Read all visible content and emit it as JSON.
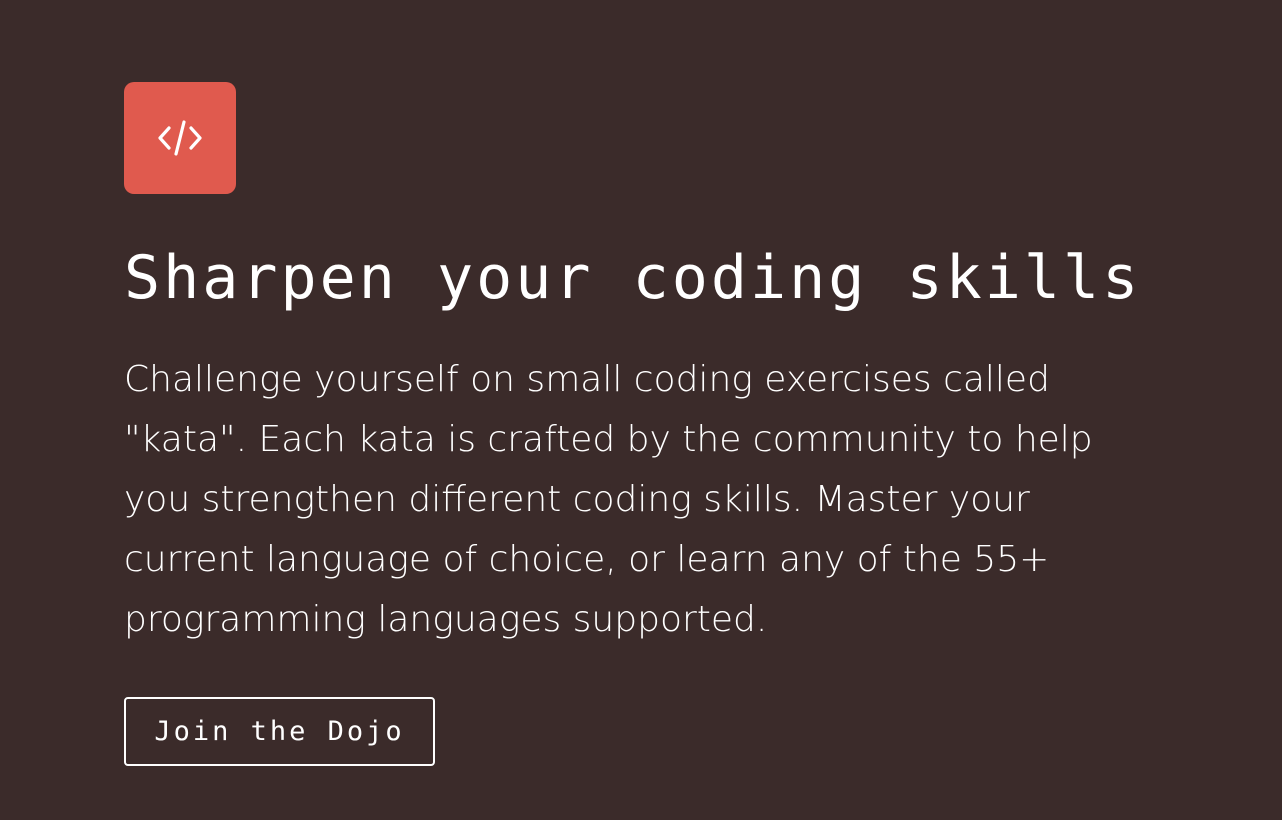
{
  "hero": {
    "icon": "code-brackets-icon",
    "title": "Sharpen your coding skills",
    "description": "Challenge yourself on small coding exercises called \"kata\". Each kata is crafted by the community to help you strengthen different coding skills. Master your current language of choice, or learn any of the 55+ programming languages supported.",
    "cta_label": "Join the Dojo"
  },
  "colors": {
    "background": "#3b2b2a",
    "accent": "#e05a4e",
    "text": "#ffffff"
  }
}
